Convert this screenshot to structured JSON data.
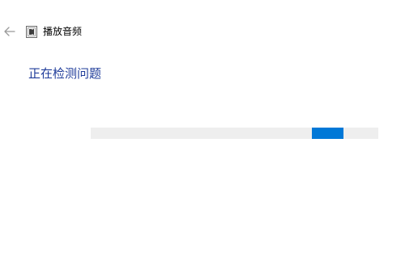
{
  "window": {
    "title": "播放音频",
    "back_icon": "arrow-left-icon",
    "title_icon": "troubleshooter-icon"
  },
  "main": {
    "heading": "正在检测问题",
    "progress": {
      "type": "indeterminate",
      "indicator_start_fraction": 0.77,
      "indicator_length_fraction": 0.11
    }
  },
  "colors": {
    "heading": "#1f3c9a",
    "progress_track": "#eeeeee",
    "progress_indicator": "#0078d7",
    "back_arrow": "#999999"
  }
}
